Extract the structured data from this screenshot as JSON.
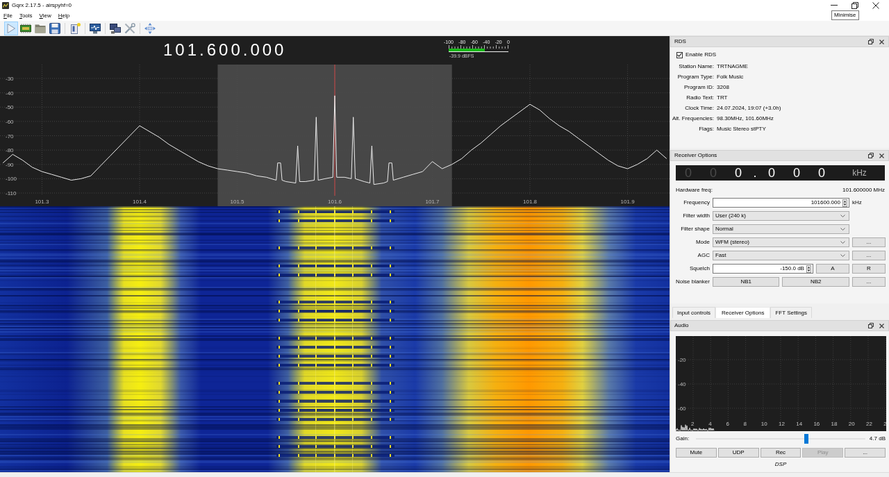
{
  "window": {
    "title": "Gqrx 2.17.5 - airspyhf=0",
    "tooltip": "Minimise"
  },
  "menu": [
    "File",
    "Tools",
    "View",
    "Help"
  ],
  "toolbar": {
    "play_checked": true
  },
  "spectrum": {
    "frequency": "101.600.000",
    "meter": {
      "scale": [
        "-100",
        "-80",
        "-60",
        "-40",
        "-20",
        "0"
      ],
      "level": 0.6,
      "reading": "-39.9 dBFS"
    },
    "chart_data": [
      {
        "type": "line",
        "x": [
          101.26,
          101.27,
          101.28,
          101.29,
          101.3,
          101.31,
          101.32,
          101.33,
          101.34,
          101.35,
          101.36,
          101.37,
          101.38,
          101.39,
          101.4,
          101.41,
          101.42,
          101.43,
          101.44,
          101.45,
          101.46,
          101.47,
          101.48,
          101.49,
          101.5,
          101.51,
          101.52,
          101.53,
          101.54,
          101.5415,
          101.5445,
          101.546,
          101.55,
          101.56,
          101.562,
          101.564,
          101.57,
          101.579,
          101.581,
          101.583,
          101.59,
          101.598,
          101.6,
          101.602,
          101.61,
          101.617,
          101.619,
          101.621,
          101.63,
          101.636,
          101.638,
          101.64,
          101.65,
          101.654,
          101.6555,
          101.6585,
          101.66,
          101.67,
          101.68,
          101.69,
          101.7,
          101.71,
          101.72,
          101.73,
          101.74,
          101.75,
          101.76,
          101.77,
          101.78,
          101.79,
          101.8,
          101.81,
          101.82,
          101.83,
          101.84,
          101.85,
          101.86,
          101.87,
          101.88,
          101.89,
          101.9,
          101.91,
          101.92,
          101.93,
          101.94
        ],
        "values": [
          -89,
          -83,
          -87,
          -92,
          -95,
          -97,
          -99,
          -101,
          -100,
          -98,
          -91,
          -84,
          -77,
          -70,
          -63,
          -67,
          -71,
          -76,
          -80,
          -84,
          -88,
          -91,
          -93,
          -94,
          -95,
          -96,
          -98,
          -99,
          -101,
          -89,
          -89,
          -101,
          -102,
          -103,
          -77,
          -102,
          -102,
          -101,
          -57,
          -101,
          -100,
          -99,
          -42,
          -99,
          -99,
          -100,
          -57,
          -100,
          -102,
          -103,
          -77,
          -104,
          -103,
          -102,
          -89,
          -89,
          -101,
          -99,
          -97,
          -95,
          -88,
          -93,
          -90,
          -86,
          -80,
          -75,
          -69,
          -63,
          -58,
          -53,
          -48,
          -52,
          -58,
          -63,
          -67,
          -72,
          -77,
          -82,
          -87,
          -91,
          -93,
          -90,
          -86,
          -80,
          -86
        ],
        "color": "#ececec",
        "xlim": [
          101.257,
          101.943
        ],
        "ylim": [
          -119.2,
          -0.4
        ],
        "xticks": [
          101.3,
          101.4,
          101.5,
          101.6,
          101.7,
          101.8,
          101.9
        ],
        "yticks": [
          -30,
          -40,
          -50,
          -60,
          -70,
          -80,
          -90,
          -100,
          -110
        ],
        "grid": true,
        "bands": [
          {
            "axis": "x",
            "from": 101.48,
            "to": 101.72,
            "color": "#474747"
          }
        ],
        "ref_lines": [
          {
            "axis": "x",
            "value": 101.6,
            "color": "#d04848"
          }
        ]
      }
    ]
  },
  "rds": {
    "title": "RDS",
    "enable": {
      "label": "Enable RDS",
      "checked": true
    },
    "fields": [
      {
        "label": "Station Name:",
        "value": "TRTNAGME"
      },
      {
        "label": "Program Type:",
        "value": "Folk Music"
      },
      {
        "label": "Program ID:",
        "value": "3208"
      },
      {
        "label": "Radio Text:",
        "value": "TRT"
      },
      {
        "label": "Clock Time:",
        "value": "24.07.2024, 19:07 (+3.0h)"
      },
      {
        "label": "Alt. Frequencies:",
        "value": "98.30MHz, 101.60MHz"
      },
      {
        "label": "Flags:",
        "value": "Music Stereo stPTY"
      }
    ]
  },
  "receiver": {
    "title": "Receiver Options",
    "offset_display": {
      "digits": [
        {
          "kind": "digit",
          "text": "0",
          "dim": true
        },
        {
          "kind": "digit",
          "text": "0",
          "dim": true
        },
        {
          "kind": "digit",
          "text": "0",
          "dim": false
        },
        {
          "kind": "separator",
          "text": ".",
          "dim": false
        },
        {
          "kind": "digit",
          "text": "0",
          "dim": false
        },
        {
          "kind": "digit",
          "text": "0",
          "dim": false
        },
        {
          "kind": "digit",
          "text": "0",
          "dim": false
        }
      ],
      "unit": "kHz"
    },
    "hardware_freq": {
      "label": "Hardware freq:",
      "value": "101.600000 MHz"
    },
    "rows": [
      {
        "label": "Frequency",
        "field": [
          {
            "kind": "spinbox",
            "value": "101600.000"
          }
        ],
        "side": {
          "kind": "unit",
          "text": "kHz"
        }
      },
      {
        "label": "Filter width",
        "field": [
          {
            "kind": "dropdown",
            "value": "User (240 k)"
          }
        ]
      },
      {
        "label": "Filter shape",
        "field": [
          {
            "kind": "dropdown",
            "value": "Normal"
          }
        ]
      },
      {
        "label": "Mode",
        "field": [
          {
            "kind": "dropdown",
            "value": "WFM (stereo)"
          }
        ],
        "side": {
          "kind": "button",
          "label": "..."
        }
      },
      {
        "label": "AGC",
        "field": [
          {
            "kind": "dropdown",
            "value": "Fast"
          }
        ],
        "side": {
          "kind": "button",
          "label": "..."
        }
      },
      {
        "label": "Squelch",
        "field": [
          {
            "kind": "spinbox",
            "value": "-150.0 dB"
          },
          {
            "kind": "button",
            "label": "A"
          }
        ],
        "side": {
          "kind": "button",
          "label": "R"
        }
      },
      {
        "label": "Noise blanker",
        "field": [
          {
            "kind": "button",
            "label": "NB1"
          },
          {
            "kind": "button",
            "label": "NB2"
          }
        ],
        "side": {
          "kind": "button",
          "label": "..."
        }
      }
    ]
  },
  "dock_tabs": [
    {
      "label": "Input controls",
      "selected": false
    },
    {
      "label": "Receiver Options",
      "selected": true
    },
    {
      "label": "FFT Settings",
      "selected": false
    }
  ],
  "audio": {
    "title": "Audio",
    "plot": {
      "y_labels": [
        "-20",
        "-40",
        "-60"
      ],
      "x_labels": [
        "2",
        "4",
        "6",
        "8",
        "10",
        "12",
        "14",
        "16",
        "18",
        "20",
        "22",
        "2"
      ]
    },
    "gain": {
      "label": "Gain:",
      "level": 0.65,
      "reading": "4.7 dB"
    },
    "buttons": [
      {
        "label": "Mute",
        "disabled": false
      },
      {
        "label": "UDP",
        "disabled": false
      },
      {
        "label": "Rec",
        "disabled": false
      },
      {
        "label": "Play",
        "disabled": true
      },
      {
        "label": "...",
        "disabled": false
      }
    ],
    "footer": "DSP"
  }
}
